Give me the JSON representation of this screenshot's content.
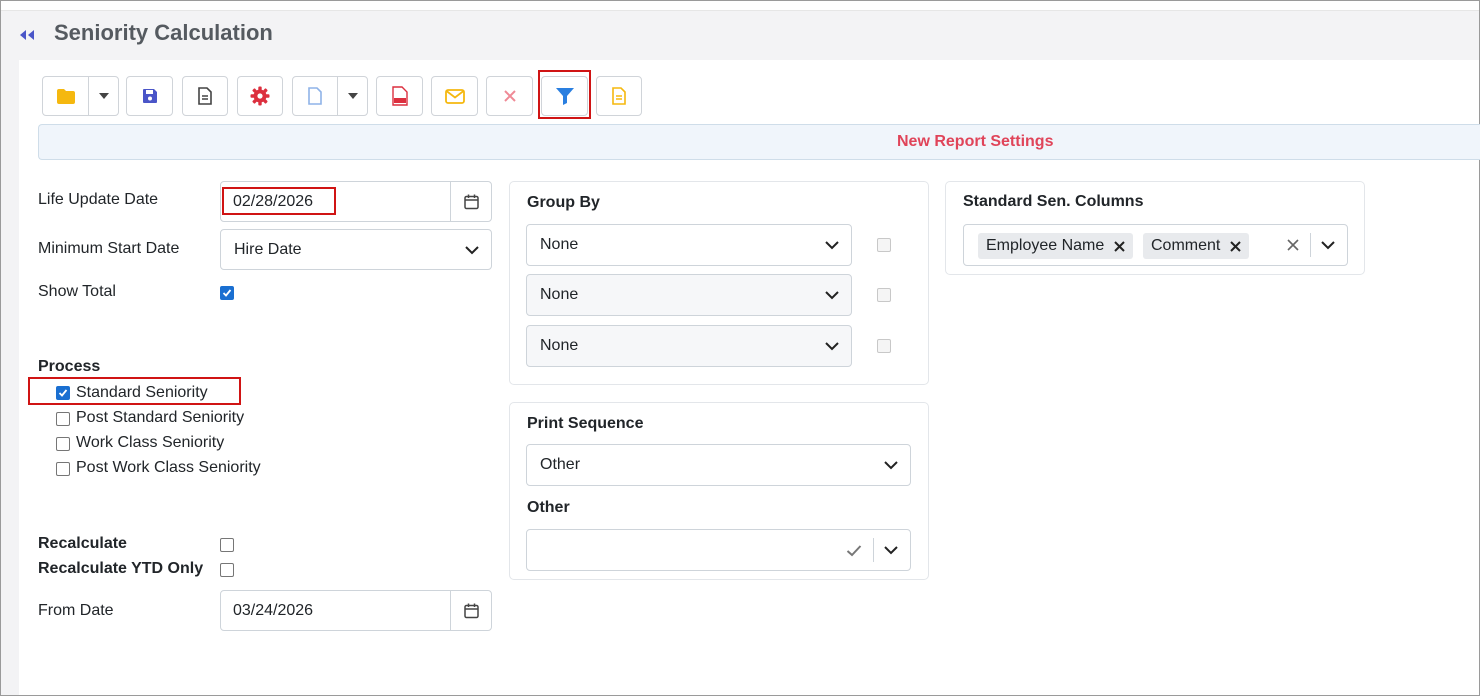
{
  "header": {
    "title": "Seniority Calculation"
  },
  "banner": {
    "text": "New Report Settings"
  },
  "form": {
    "life_update_label": "Life Update Date",
    "life_update_value": "02/28/2026",
    "min_start_label": "Minimum Start Date",
    "min_start_value": "Hire Date",
    "show_total_label": "Show Total",
    "show_total_checked": true,
    "process_label": "Process",
    "process_options": [
      {
        "label": "Standard Seniority",
        "checked": true
      },
      {
        "label": "Post Standard Seniority",
        "checked": false
      },
      {
        "label": "Work Class Seniority",
        "checked": false
      },
      {
        "label": "Post Work Class Seniority",
        "checked": false
      }
    ],
    "recalculate_label": "Recalculate",
    "recalculate_ytd_label": "Recalculate YTD Only",
    "from_date_label": "From Date",
    "from_date_value": "03/24/2026"
  },
  "group_by": {
    "title": "Group By",
    "selects": [
      "None",
      "None",
      "None"
    ]
  },
  "print_sequence": {
    "title": "Print Sequence",
    "value": "Other",
    "other_label": "Other",
    "other_value": ""
  },
  "standard_columns": {
    "title": "Standard Sen. Columns",
    "chips": [
      "Employee Name",
      "Comment"
    ]
  },
  "colors": {
    "accent_blue": "#1a6fd1",
    "banner_red": "#e04459",
    "highlight_red": "#d01414"
  }
}
